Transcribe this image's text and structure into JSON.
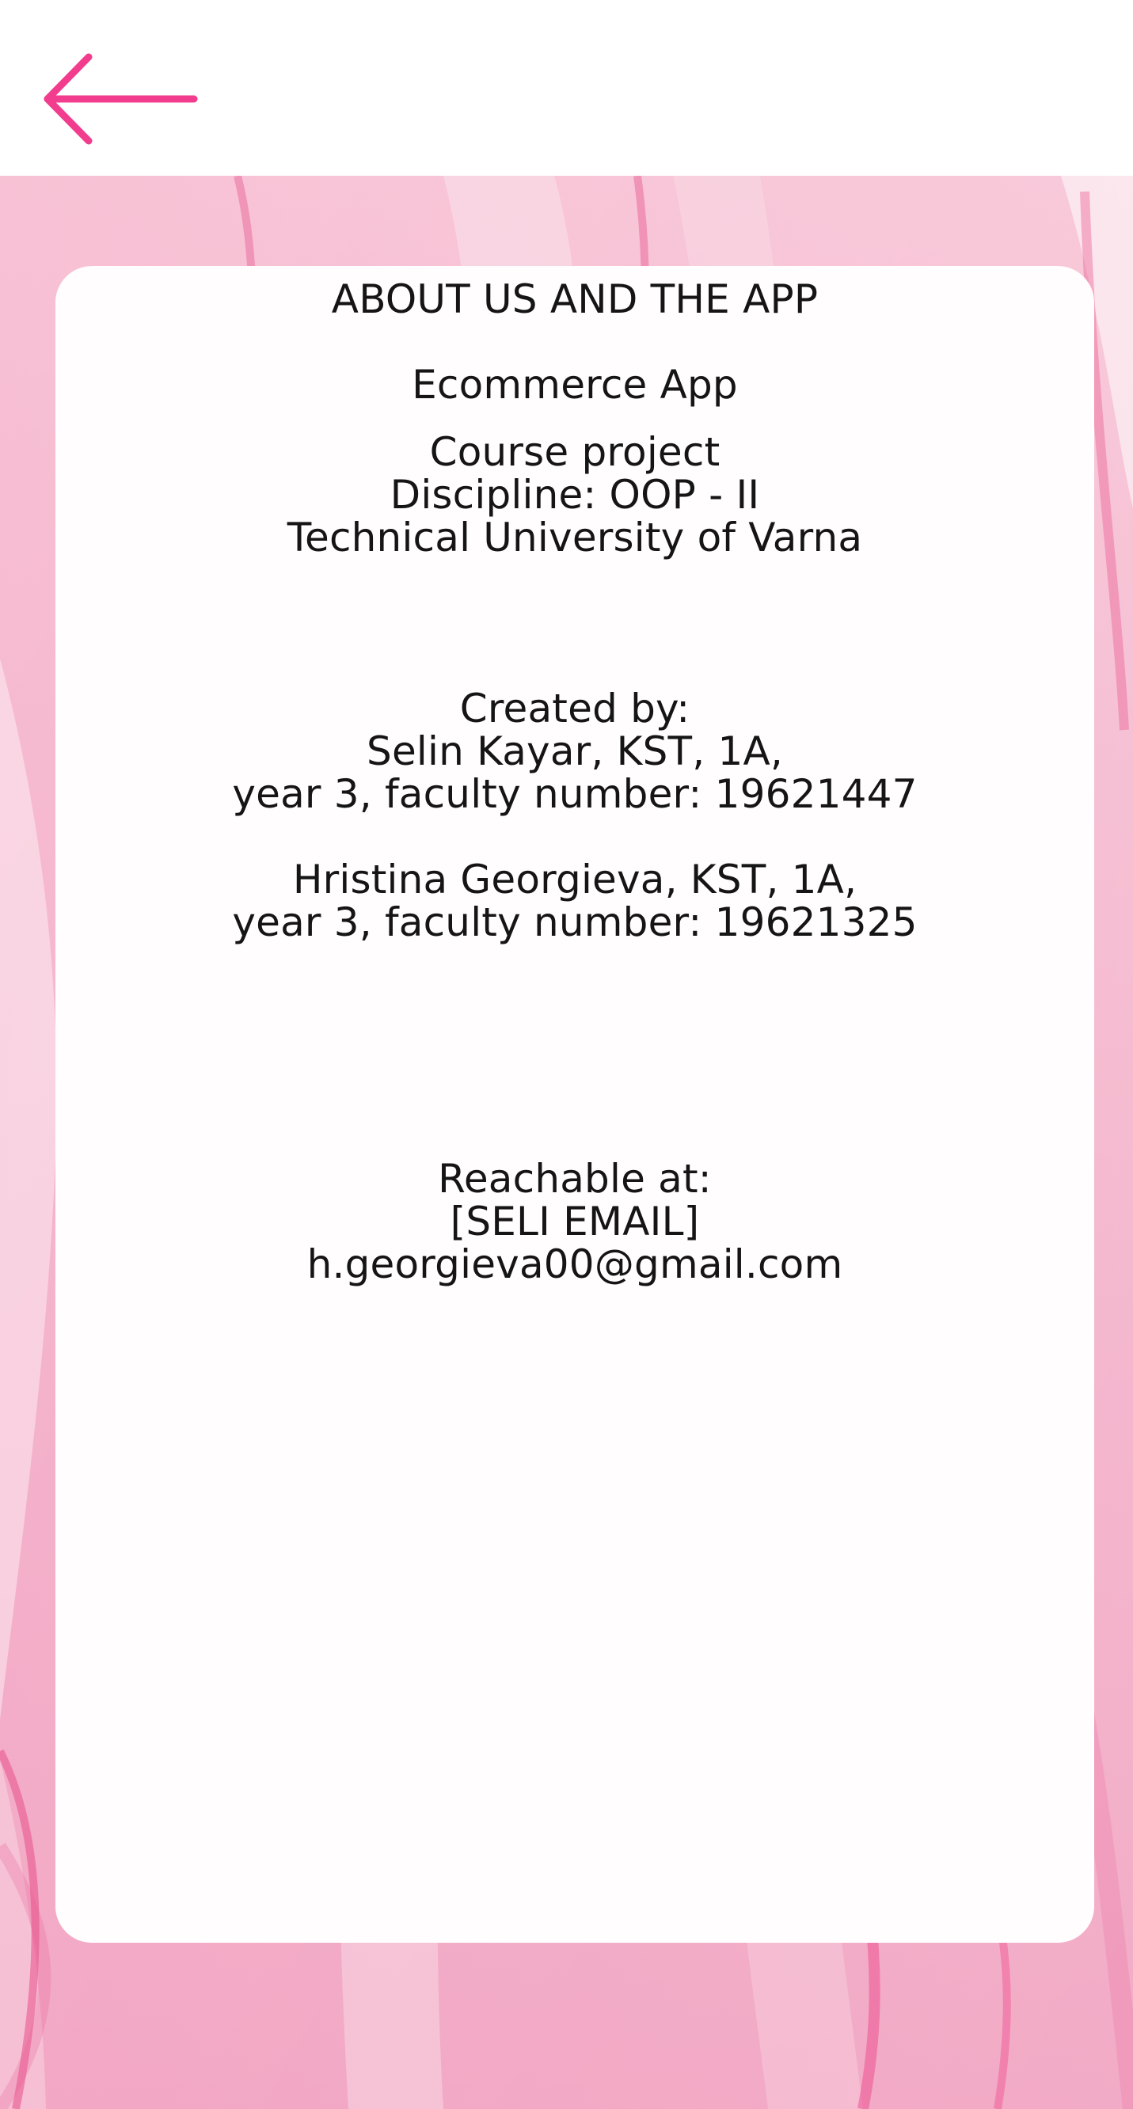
{
  "header": {
    "back_icon": "arrow-left-icon",
    "accent_color": "#f23c8d"
  },
  "about": {
    "title": "ABOUT US AND THE APP",
    "app_name": "Ecommerce App",
    "project": {
      "line1": "Course project",
      "line2": "Discipline: OOP - II",
      "line3": "Technical University of Varna"
    },
    "created_by": {
      "label": "Created by:",
      "author1_line1": "Selin Kayar, KST, 1A,",
      "author1_line2": "year 3, faculty number: 19621447",
      "author2_line1": "Hristina Georgieva, KST, 1A,",
      "author2_line2": "year 3, faculty number: 19621325"
    },
    "contact": {
      "label": "Reachable at:",
      "email1": "[SELI EMAIL]",
      "email2": "h.georgieva00@gmail.com"
    }
  },
  "background": {
    "base_color": "#f6bfd3",
    "stroke_color": "#ec4f8f",
    "highlight_color": "#ffffff"
  }
}
